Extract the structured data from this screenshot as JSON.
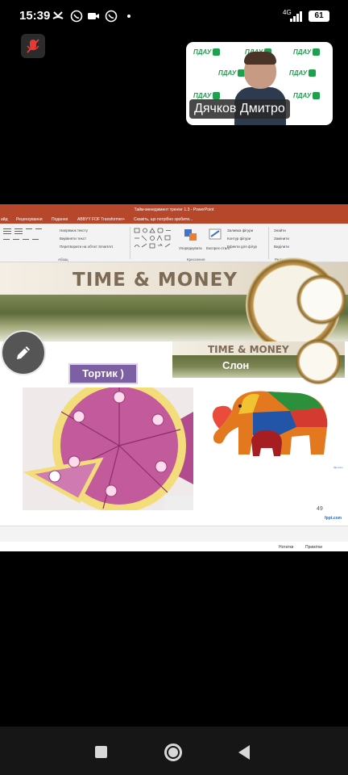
{
  "status_bar": {
    "time": "15:39",
    "network": "4G",
    "battery": "61"
  },
  "call": {
    "participant_name": "Дячков Дмитро",
    "logo_text": "ПДАУ"
  },
  "powerpoint": {
    "window_title": "Тайм-менеджмент тренінг 1.3 - PowerPoint",
    "tabs": [
      "айд",
      "Рецензування",
      "Подання",
      "ABBYY FOF Transformer+",
      "Скажіть, що потрібно зробити..."
    ],
    "ribbon": {
      "text_direction": "Напрямок тексту",
      "align_text": "Вирівняти текст",
      "convert_smartart": "Перетворити на об'єкт SmartArt",
      "group_paragraph": "Абзац",
      "arrange": "Упорядкувати",
      "quick_styles": "Експрес-стилі",
      "shape_fill": "Заливка фігури",
      "shape_outline": "Контур фігури",
      "shape_effects": "Ефекти для фігур",
      "group_drawing": "Креслення",
      "find": "Знайти",
      "replace": "Замінити",
      "select": "Виділити",
      "group_editing": "Редагування"
    },
    "slide": {
      "title": "TIME & MONEY",
      "mini_title": "TIME & MONEY",
      "label_elephant": "Слон",
      "label_cake": "Тортик )",
      "slide_number": "49",
      "footer_brand": "fppt.com",
      "small_brand": "fppt.com"
    },
    "status": {
      "notes": "Нотатки",
      "comments": "Примітки"
    }
  },
  "colors": {
    "ppt_accent": "#b7472a",
    "tortik_box": "#7d5fa3"
  }
}
